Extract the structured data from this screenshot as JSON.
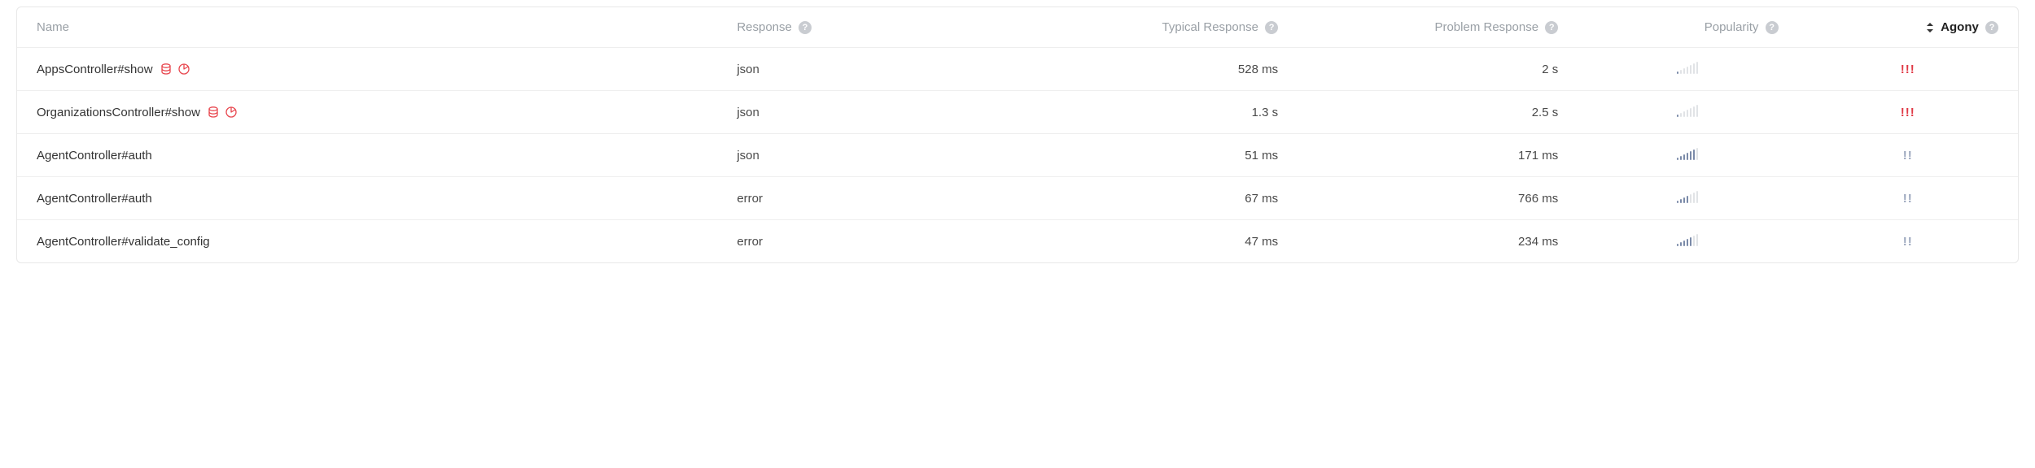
{
  "columns": {
    "name": "Name",
    "response": "Response",
    "typical": "Typical Response",
    "problem": "Problem Response",
    "popularity": "Popularity",
    "agony": "Agony"
  },
  "sorted_column": "agony",
  "rows": [
    {
      "name": "AppsController#show",
      "has_db_icon": true,
      "has_chart_icon": true,
      "response": "json",
      "typical": "528 ms",
      "problem": "2 s",
      "popularity_level": 1,
      "agony_level": 3,
      "agony_text": "!!!"
    },
    {
      "name": "OrganizationsController#show",
      "has_db_icon": true,
      "has_chart_icon": true,
      "response": "json",
      "typical": "1.3 s",
      "problem": "2.5 s",
      "popularity_level": 1,
      "agony_text": "!!!",
      "agony_level": 3
    },
    {
      "name": "AgentController#auth",
      "has_db_icon": false,
      "has_chart_icon": false,
      "response": "json",
      "typical": "51 ms",
      "problem": "171 ms",
      "popularity_level": 6,
      "agony_text": "!!",
      "agony_level": 2
    },
    {
      "name": "AgentController#auth",
      "has_db_icon": false,
      "has_chart_icon": false,
      "response": "error",
      "typical": "67 ms",
      "problem": "766 ms",
      "popularity_level": 4,
      "agony_text": "!!",
      "agony_level": 2
    },
    {
      "name": "AgentController#validate_config",
      "has_db_icon": false,
      "has_chart_icon": false,
      "response": "error",
      "typical": "47 ms",
      "problem": "234 ms",
      "popularity_level": 5,
      "agony_text": "!!",
      "agony_level": 2
    }
  ],
  "icons": {
    "db_color": "#e8474f",
    "chart_color": "#e8474f"
  }
}
